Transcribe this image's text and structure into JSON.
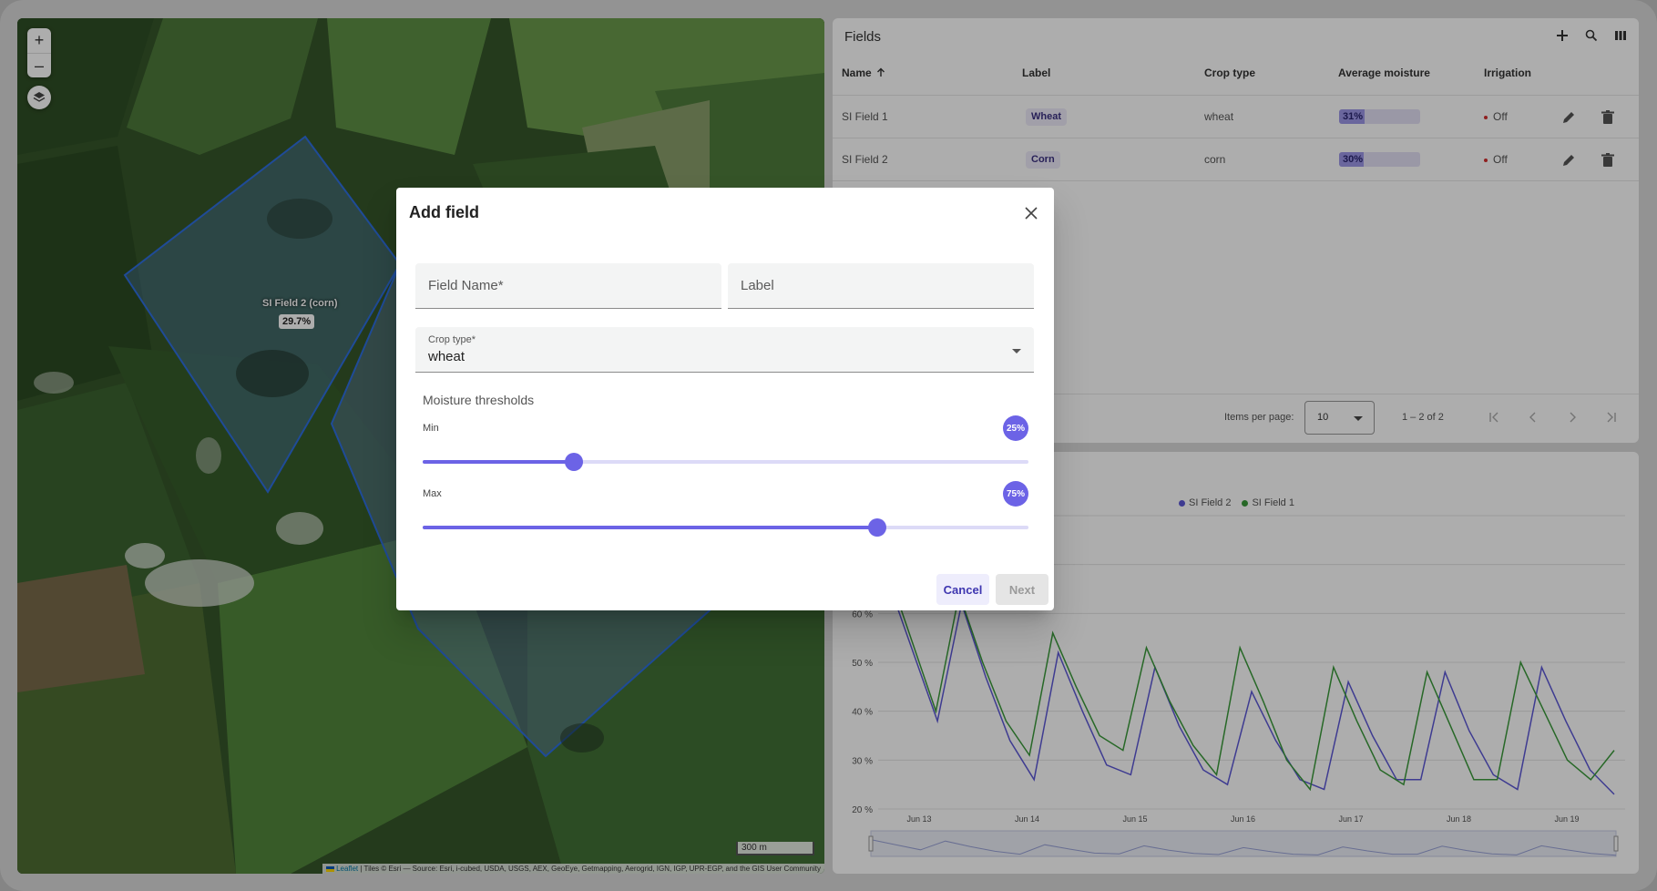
{
  "map": {
    "zoom_in_label": "+",
    "zoom_out_label": "–",
    "layers_icon": "layers-icon",
    "field_label": "SI Field 2 (corn)",
    "field_value": "29.7%",
    "scale_label": "300 m",
    "attribution": {
      "flag_icon": "ukraine-flag-icon",
      "link": "Leaflet",
      "text": " | Tiles © Esri — Source: Esri, i-cubed, USDA, USGS, AEX, GeoEye, Getmapping, Aerogrid, IGN, IGP, UPR-EGP, and the GIS User Community"
    }
  },
  "fields": {
    "title": "Fields",
    "tool_icons": [
      "add-icon",
      "search-icon",
      "columns-icon"
    ],
    "columns": {
      "name": "Name",
      "label": "Label",
      "crop": "Crop type",
      "moisture": "Average moisture",
      "irrigation": "Irrigation"
    },
    "rows": [
      {
        "name": "SI Field 1",
        "label": "Wheat",
        "crop": "wheat",
        "moisture_text": "31%",
        "moisture": 31,
        "irrigation": "Off"
      },
      {
        "name": "SI Field 2",
        "label": "Corn",
        "crop": "corn",
        "moisture_text": "30%",
        "moisture": 30,
        "irrigation": "Off"
      }
    ],
    "paginator": {
      "items_per_page_label": "Items per page:",
      "page_size": "10",
      "range": "1 – 2 of 2"
    }
  },
  "chart_data": {
    "type": "line",
    "series": [
      {
        "name": "SI Field 2",
        "color": "#5c58d6",
        "values": [
          66,
          52,
          38,
          62,
          47,
          34,
          26,
          52,
          40,
          29,
          27,
          49,
          37,
          28,
          25,
          44,
          34,
          26,
          24,
          46,
          35,
          26,
          26,
          48,
          36,
          27,
          24,
          49,
          38,
          28,
          23
        ]
      },
      {
        "name": "SI Field 1",
        "color": "#3a9a3a",
        "values": [
          68,
          54,
          40,
          64,
          50,
          38,
          31,
          56,
          45,
          35,
          32,
          53,
          42,
          33,
          27,
          53,
          42,
          30,
          24,
          49,
          38,
          28,
          25,
          48,
          37,
          26,
          26,
          50,
          40,
          30,
          26,
          32
        ]
      }
    ],
    "x_ticks": [
      "Jun 13",
      "Jun 14",
      "Jun 15",
      "Jun 16",
      "Jun 17",
      "Jun 18",
      "Jun 19"
    ],
    "y_ticks": [
      "20 %",
      "30 %",
      "40 %",
      "50 %",
      "60 %"
    ],
    "ylim": [
      20,
      80
    ],
    "grid": true,
    "legend": "top-center"
  },
  "dialog": {
    "title": "Add field",
    "close_icon": "close-icon",
    "field_name_placeholder": "Field Name*",
    "label_placeholder": "Label",
    "crop_label": "Crop type*",
    "crop_value": "wheat",
    "thresholds_title": "Moisture thresholds",
    "min_label": "Min",
    "min_value": "25%",
    "min_fraction": 0.25,
    "max_label": "Max",
    "max_value": "75%",
    "max_fraction": 0.75,
    "cancel_label": "Cancel",
    "next_label": "Next"
  }
}
